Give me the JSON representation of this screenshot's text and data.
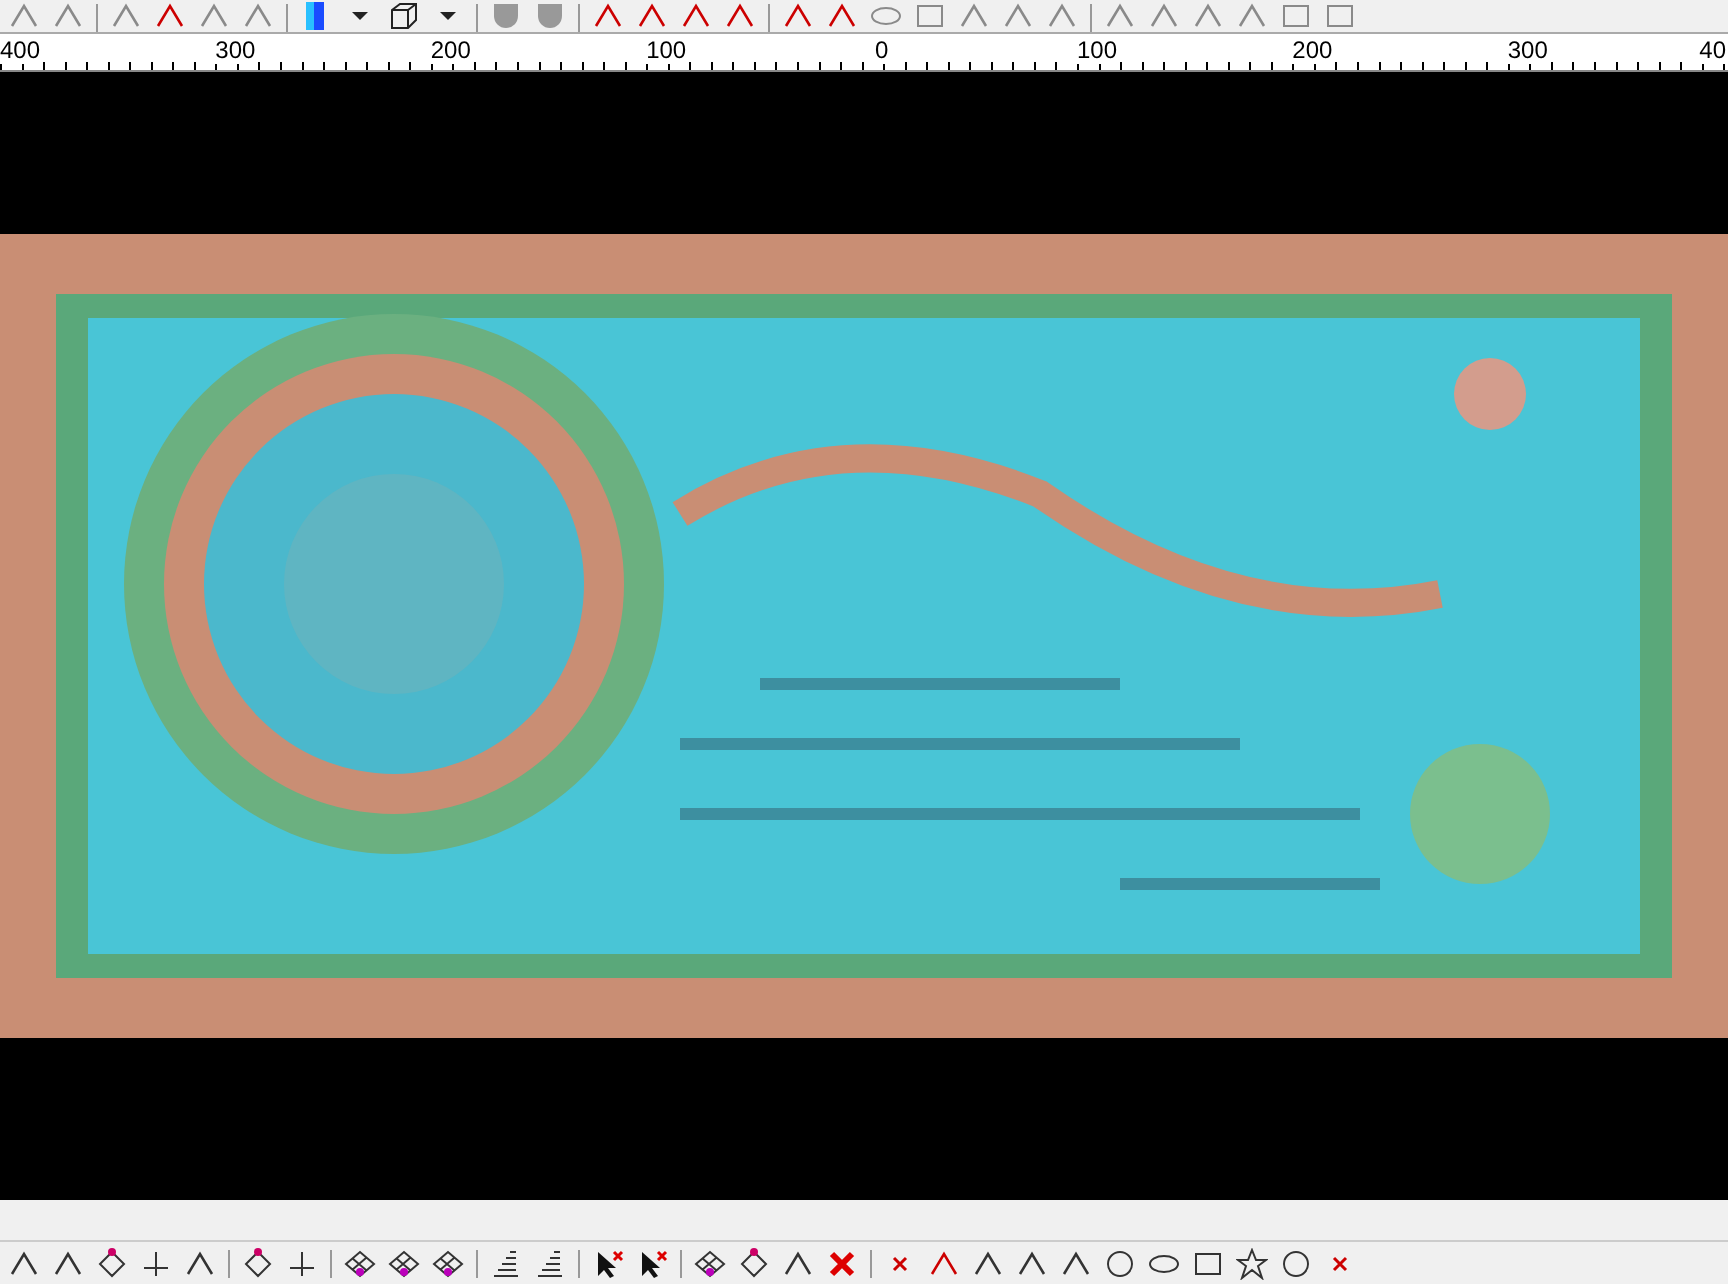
{
  "ruler": {
    "labels": [
      "400",
      "300",
      "200",
      "100",
      "0",
      "100",
      "200",
      "300",
      "40"
    ]
  }
}
